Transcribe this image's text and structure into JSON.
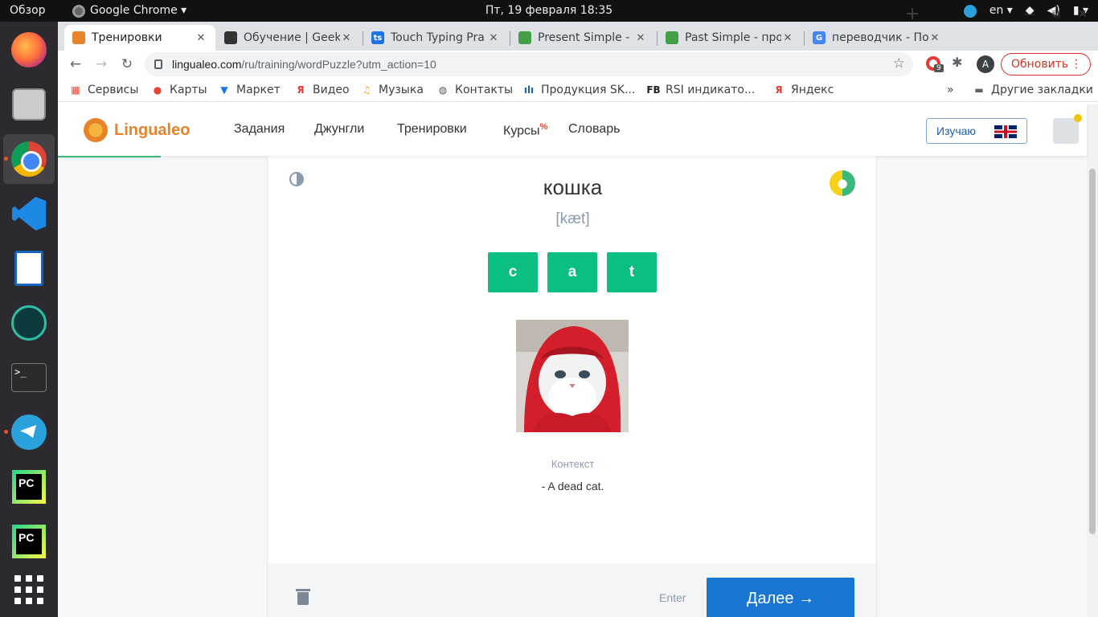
{
  "desktop": {
    "activities": "Обзор",
    "app_menu": "Google Chrome ▾",
    "clock": "Пт, 19 февраля  18:35",
    "keyboard_layout": "en ▾",
    "accent": "#e95420",
    "dock": [
      "firefox-icon",
      "files-icon",
      "chrome-icon",
      "vscode-icon",
      "writer-icon",
      "gitkraken-icon",
      "terminal-icon",
      "telegram-icon",
      "pycharm-icon",
      "pycharm-ce-icon",
      "app-grid-icon"
    ],
    "terminal_glyph": ">_",
    "pycharm_label": "PC"
  },
  "browser": {
    "tabs": [
      {
        "title": "Тренировки",
        "favicon": "lingualeo-icon",
        "color": "#e8832a",
        "active": true
      },
      {
        "title": "Обучение | GeekB",
        "favicon": "geekbrains-icon",
        "color": "#333333",
        "active": false
      },
      {
        "title": "Touch Typing Pra",
        "favicon": "typingstudy-icon",
        "color": "#1a73e8",
        "glyph": "ts",
        "active": false
      },
      {
        "title": "Present Simple - п",
        "favicon": "leaf-icon",
        "color": "#43a047",
        "active": false
      },
      {
        "title": "Past Simple - про",
        "favicon": "leaf-icon",
        "color": "#43a047",
        "active": false
      },
      {
        "title": "переводчик - По",
        "favicon": "google-icon",
        "color": "#4285f4",
        "glyph": "G",
        "active": false
      }
    ],
    "url_host": "lingualeo.com",
    "url_path": "/ru/training/wordPuzzle?utm_action=10",
    "extension_badge": "9",
    "profile_initial": "A",
    "update_label": "Обновить",
    "bookmarks": [
      {
        "label": "Сервисы",
        "icon": "apps-grid-icon"
      },
      {
        "label": "Карты",
        "icon": "maps-pin-icon"
      },
      {
        "label": "Маркет",
        "icon": "cart-icon"
      },
      {
        "label": "Видео",
        "icon": "yandex-icon"
      },
      {
        "label": "Музыка",
        "icon": "music-icon"
      },
      {
        "label": "Контакты",
        "icon": "globe-icon"
      },
      {
        "label": "Продукция SK...",
        "icon": "skoltech-icon"
      },
      {
        "label": "RSI индикато...",
        "icon": "fb-icon"
      },
      {
        "label": "Яндекс",
        "icon": "yandex-icon"
      }
    ],
    "bookmarks_overflow": "»",
    "other_bookmarks": "Другие закладки"
  },
  "site": {
    "logo_text": "Lingualeo",
    "nav": [
      "Задания",
      "Джунгли",
      "Тренировки",
      "Курсы",
      "Словарь"
    ],
    "courses_badge": "%",
    "learn_button": "Изучаю",
    "brand_color": "#e8832a",
    "green_color": "#0abf7f",
    "blue_color": "#1976d2"
  },
  "training": {
    "word": "кошка",
    "transcription": "[kæt]",
    "letters": [
      "c",
      "a",
      "t"
    ],
    "picture": "cat-in-red-hood",
    "context_label": "Контекст",
    "context_text": "- A dead cat.",
    "enter_hint": "Enter",
    "next_button": "Далее →"
  }
}
